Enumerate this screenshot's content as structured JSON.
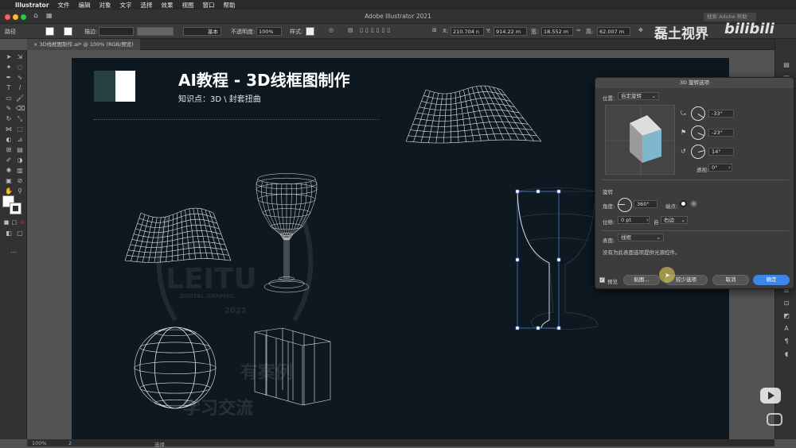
{
  "menubar": {
    "app": "Illustrator",
    "items": [
      "文件",
      "编辑",
      "对象",
      "文字",
      "选择",
      "效果",
      "视图",
      "窗口",
      "帮助"
    ]
  },
  "window": {
    "title": "Adobe Illustrator 2021",
    "search_placeholder": "搜索 Adobe 帮助"
  },
  "control_bar": {
    "object_type": "路径",
    "stroke_label": "描边:",
    "stroke_style": "基本",
    "opacity_label": "不透明度:",
    "opacity_value": "100%",
    "style_label": "样式:",
    "x_label": "X:",
    "x_value": "210.704 n",
    "y_label": "Y:",
    "y_value": "914.22 m",
    "w_label": "宽:",
    "w_value": "18.552 m",
    "h_label": "高:",
    "h_value": "62.007 m"
  },
  "document_tab": {
    "label": "3D线框图制作.ai* @ 100% (RGB/预览)"
  },
  "artboard": {
    "heading": "AI教程 - 3D线框图制作",
    "subheading": "知识点：3D \\ 封套扭曲",
    "colors": {
      "bg": "#0d1820",
      "swatch_dark": "#26403f",
      "swatch_light": "#ffffff",
      "selection": "#4b7bd8"
    }
  },
  "watermark": {
    "brand_top": "LEITU",
    "brand_sub": "DIGITAL GRAPHIC",
    "design_label": "DESIGN",
    "year": "2022",
    "line1": "有案例",
    "line2": "学习交流",
    "channel": "磊土视界",
    "site": "bilibili"
  },
  "dialog": {
    "title": "3D 旋转选项",
    "position_label": "位置:",
    "position_value": "自定旋转",
    "rot_x": "-33°",
    "rot_y": "-23°",
    "rot_z": "14°",
    "perspective_label": "透视:",
    "perspective_value": "0°",
    "revolve_section": "旋转",
    "angle_label": "角度:",
    "angle_value": "360°",
    "cap_label": "端点:",
    "offset_label": "位移:",
    "offset_value": "0 pt",
    "from_label": "自",
    "from_value": "右边",
    "surface_label": "表面:",
    "surface_value": "线框",
    "surface_note": "没有为此表面选项提供光源控件。",
    "preview_label": "预览",
    "map_button": "贴图...",
    "fewer_button": "较少选项",
    "cancel_button": "取消",
    "ok_button": "确定",
    "cube_face_color": "#7fb8cc"
  },
  "statusbar": {
    "zoom": "100%",
    "page": "2",
    "tool": "选择"
  }
}
